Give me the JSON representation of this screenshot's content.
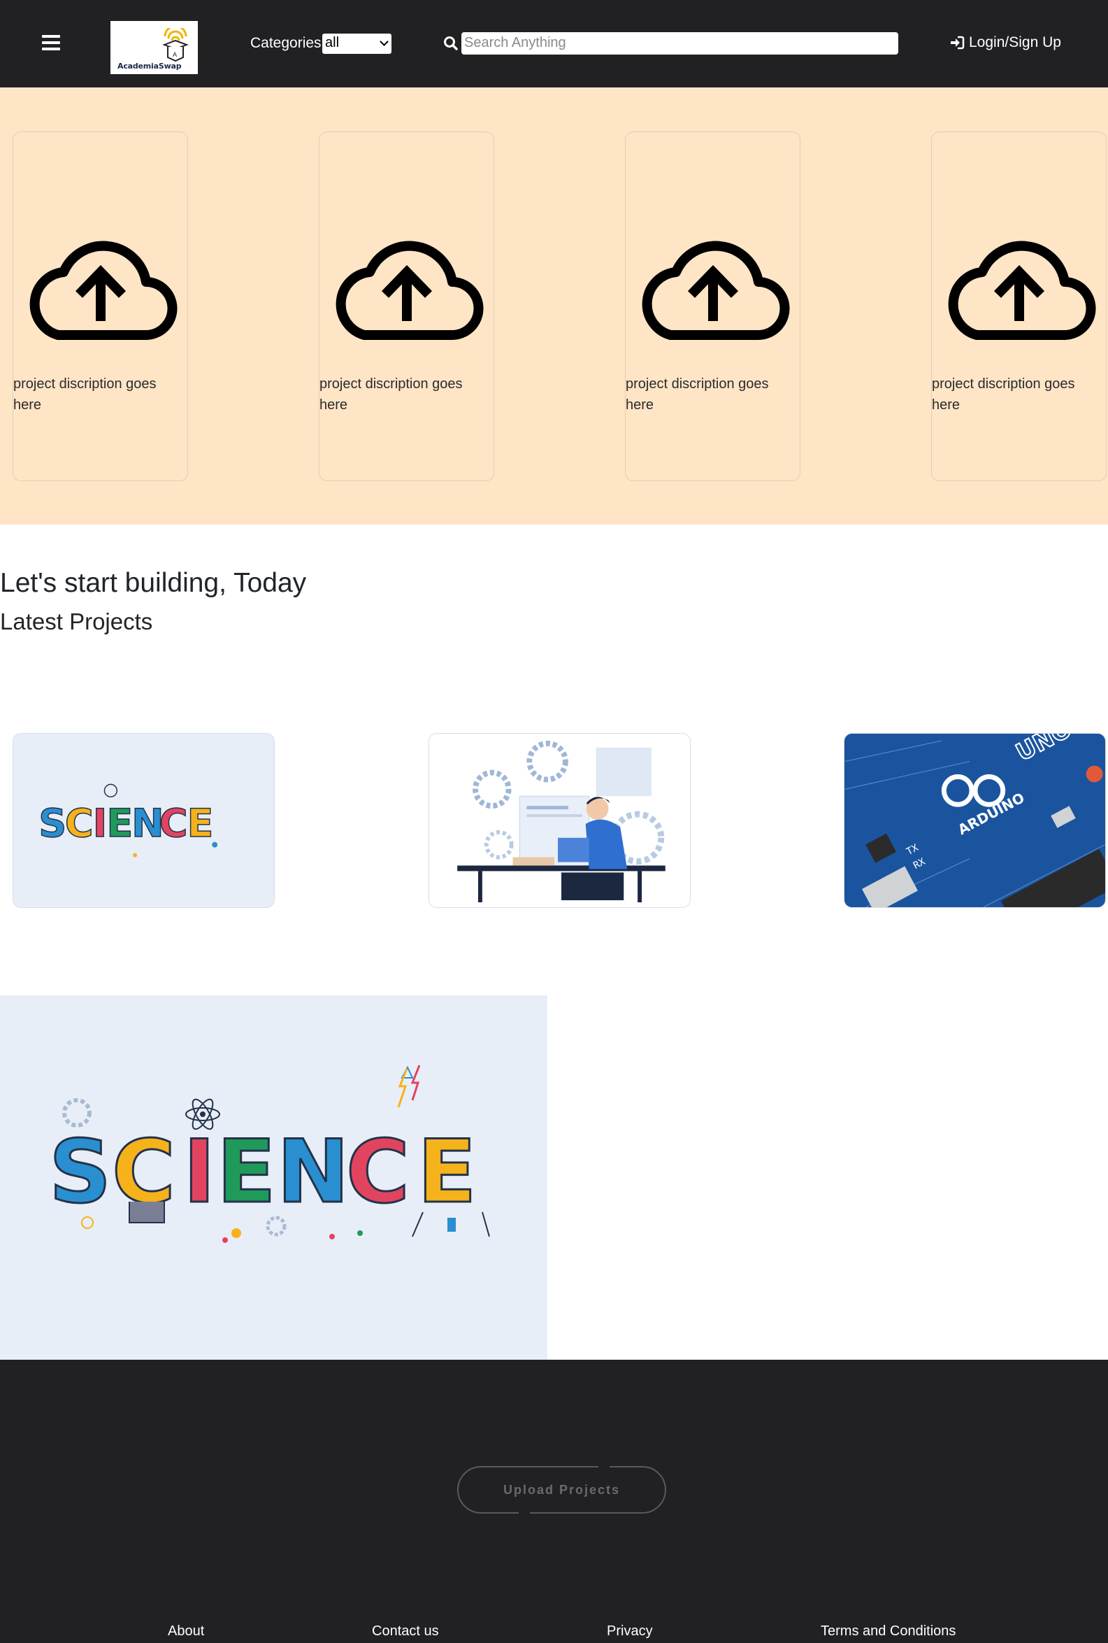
{
  "header": {
    "logo_text": "AcademiaSwap",
    "categories_label": "Categories",
    "category_selected": "all",
    "search_placeholder": "Search Anything",
    "login_label": "Login/Sign Up"
  },
  "hero": {
    "cards": [
      {
        "icon": "cloud-upload-icon",
        "description": "project discription goes here"
      },
      {
        "icon": "cloud-upload-icon",
        "description": "project discription goes here"
      },
      {
        "icon": "cloud-upload-icon",
        "description": "project discription goes here"
      },
      {
        "icon": "cloud-upload-icon",
        "description": "project discription goes here"
      }
    ]
  },
  "main": {
    "heading": "Let's start building, Today",
    "subheading": "Latest Projects",
    "projects": [
      {
        "image": "science-illustration"
      },
      {
        "image": "developer-at-desk-illustration"
      },
      {
        "image": "arduino-board-photo"
      }
    ],
    "featured_image": "science-illustration"
  },
  "footer": {
    "upload_label": "Upload Projects",
    "links": [
      "About",
      "Contact us",
      "Privacy",
      "Terms and Conditions"
    ]
  },
  "colors": {
    "header_bg": "#212023",
    "hero_bg": "#fee5c6",
    "footer_bg": "#212023"
  }
}
